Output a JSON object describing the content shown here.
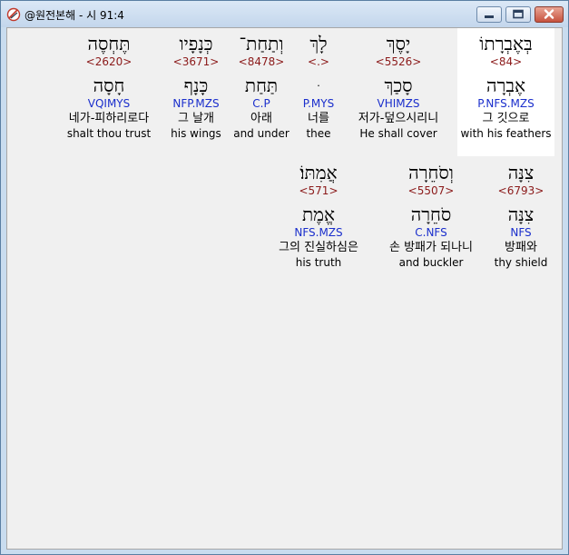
{
  "window": {
    "title": "@원전본해 - 시 91:4",
    "buttons": {
      "minimize": "minimize",
      "maximize": "maximize",
      "close": "close"
    },
    "colors": {
      "strong": "#8b1a1a",
      "morph": "#1a2ecc",
      "highlight": "#ffffff"
    }
  },
  "verse": {
    "row1": [
      {
        "heb": "בְּאֶבְרָתוֹ",
        "strong": "<84>",
        "lemma": "אֶבְרָה",
        "morph": "P.NFS.MZS",
        "kor": "그 깃으로",
        "eng": "with his feathers",
        "selected": true
      },
      {
        "heb": "יָסֶךְ",
        "strong": "<5526>",
        "lemma": "סָכַךְ",
        "morph": "VHIMZS",
        "kor": "저가-덮으시리니",
        "eng": "He shall cover"
      },
      {
        "heb": "לָךְ",
        "strong": "<.>",
        "lemma": "ּ",
        "morph": "P.MYS",
        "kor": "너를",
        "eng": "thee"
      },
      {
        "heb": "וְתַחַת־",
        "strong": "<8478>",
        "lemma": "תַּחַת",
        "morph": "C.P",
        "kor": "아래",
        "eng": "and under"
      },
      {
        "heb": "כְּנָפָיו",
        "strong": "<3671>",
        "lemma": "כָּנָף",
        "morph": "NFP.MZS",
        "kor": "그 날개",
        "eng": "his wings"
      },
      {
        "heb": "תֶּחְסֶה",
        "strong": "<2620>",
        "lemma": "חָסָה",
        "morph": "VQIMYS",
        "kor": "네가-피하리로다",
        "eng": "shalt thou trust"
      }
    ],
    "row2": [
      {
        "heb": "צִנָּה",
        "strong": "<6793>",
        "lemma": "צִנָּה",
        "morph": "NFS",
        "kor": "방패와",
        "eng": "thy shield"
      },
      {
        "heb": "וְסֹחֵרָה",
        "strong": "<5507>",
        "lemma": "סֹחֵרָה",
        "morph": "C.NFS",
        "kor": "손 방패가 되나니",
        "eng": "and buckler"
      },
      {
        "heb": "אֲמִתּוֹ׃",
        "strong": "<571>",
        "lemma": "אֱמֶת",
        "morph": "NFS.MZS",
        "kor": "그의 진실하심은",
        "eng": "his truth"
      }
    ]
  }
}
